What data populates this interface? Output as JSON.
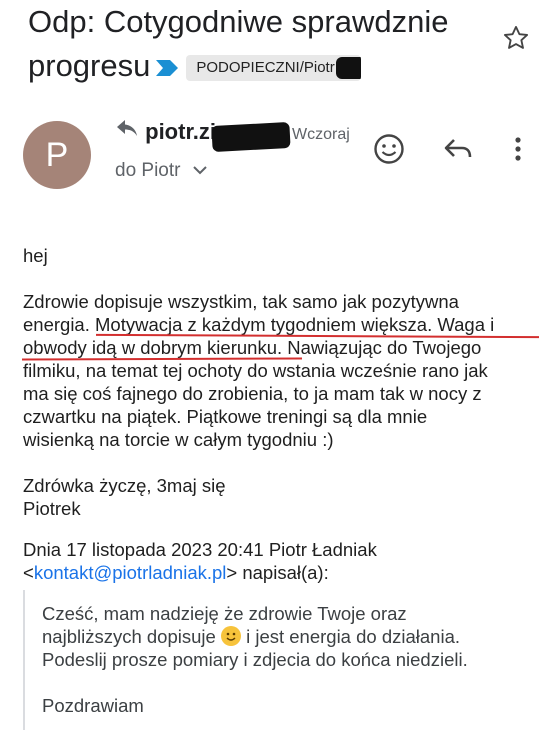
{
  "email": {
    "subject_line1": "Odp: Cotygodniwe sprawdznie",
    "subject_line2": "progresu",
    "label": "PODOPIECZNI/Piotr Zi",
    "sender": "piotr.zi",
    "time": "Wczoraj",
    "to": "do Piotr",
    "avatar_letter": "P"
  },
  "body": {
    "greeting": "hej",
    "p1_a": "Zdrowie dopisuje wszystkim, tak samo jak pozytywna",
    "p1_b": "energia. ",
    "p1_c": "Motywacja z każdym tygodniem większa. Waga i",
    "p1_d": "obwody idą w dobrym kierunku.",
    "p1_e": " Nawiązując do Twojego",
    "p1_f": "filmiku, na temat tej ochoty do wstania wcześnie rano jak",
    "p1_g": "ma się coś fajnego do zrobienia, to ja mam tak w nocy z",
    "p1_h": "czwartku na piątek. Piątkowe treningi są dla mnie",
    "p1_i": "wisienką na torcie w całym tygodniu :)",
    "closing": "Zdrówka życzę, 3maj się",
    "signature": "Piotrek",
    "reply_header_a": "Dnia 17 listopada 2023 20:41 Piotr Ładniak",
    "reply_header_b": "<",
    "reply_email": "kontakt@piotrladniak.pl",
    "reply_header_c": "> napisał(a):"
  },
  "quoted": {
    "line1": "Cześć, mam nadzieję że zdrowie Twoje oraz",
    "line2_a": "najbliższych dopisuje ",
    "line2_b": " i jest energia do działania.",
    "line3": "Podeslij prosze pomiary i zdjecia do końca niedzieli.",
    "line4": "Pozdrawiam"
  },
  "icons": {
    "star": "star-icon",
    "smile": "emoji-reaction-icon",
    "reply": "reply-icon",
    "more": "more-vert-icon",
    "label": "label-arrow-icon"
  },
  "colors": {
    "avatar": "#a58478",
    "label_arrow": "#1a8fd3",
    "underline": "#d32f2f",
    "link": "#1a73e8"
  }
}
